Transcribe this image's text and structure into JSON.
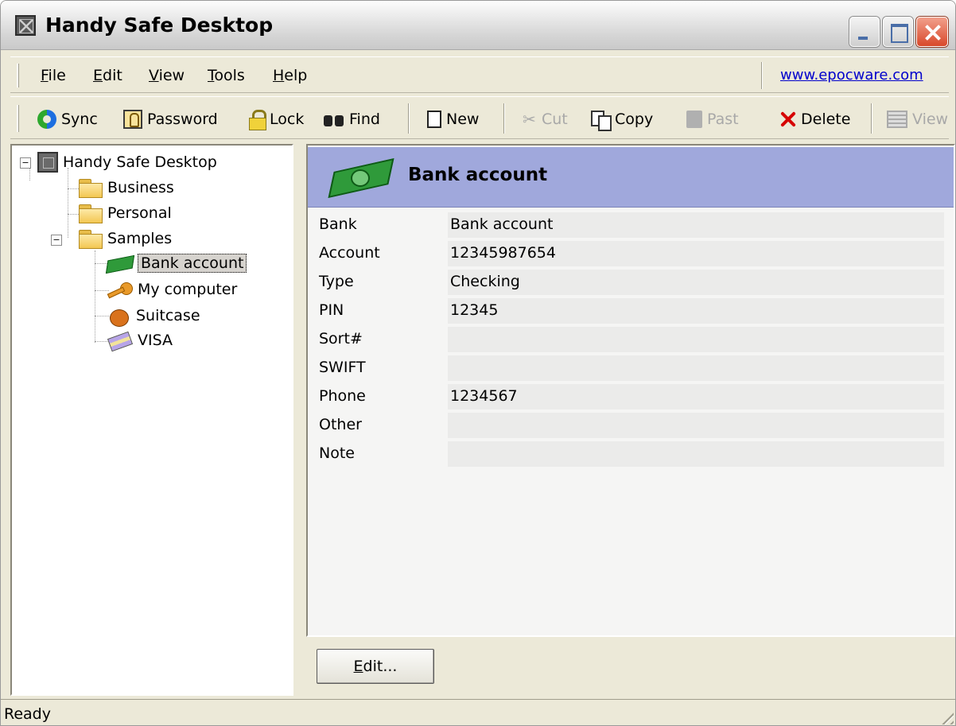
{
  "window": {
    "title": "Handy Safe Desktop"
  },
  "menu": {
    "file": {
      "accel": "F",
      "rest": "ile"
    },
    "edit": {
      "accel": "E",
      "rest": "dit"
    },
    "view": {
      "accel": "V",
      "rest": "iew"
    },
    "tools": {
      "accel": "T",
      "rest": "ools"
    },
    "help": {
      "accel": "H",
      "rest": "elp"
    },
    "website": "www.epocware.com"
  },
  "toolbar": {
    "sync": "Sync",
    "password": "Password",
    "lock": "Lock",
    "find": "Find",
    "new": "New",
    "cut": "Cut",
    "copy": "Copy",
    "paste": "Past",
    "delete": "Delete",
    "view": "View",
    "cut_icon": "✂"
  },
  "tree": {
    "root": "Handy Safe Desktop",
    "items": [
      {
        "label": "Business",
        "icon": "folder-icon"
      },
      {
        "label": "Personal",
        "icon": "folder-icon"
      },
      {
        "label": "Samples",
        "icon": "folder-icon"
      },
      {
        "label": "Bank account",
        "icon": "money-icon",
        "selected": true
      },
      {
        "label": "My computer",
        "icon": "key-icon"
      },
      {
        "label": "Suitcase",
        "icon": "suitcase-icon"
      },
      {
        "label": "VISA",
        "icon": "credit-card-icon"
      }
    ],
    "expanded_toggle": "−"
  },
  "detail": {
    "title": "Bank account",
    "fields": [
      {
        "label": "Bank",
        "value": "Bank account"
      },
      {
        "label": "Account",
        "value": "12345987654"
      },
      {
        "label": "Type",
        "value": "Checking"
      },
      {
        "label": "PIN",
        "value": "12345"
      },
      {
        "label": "Sort#",
        "value": ""
      },
      {
        "label": "SWIFT",
        "value": ""
      },
      {
        "label": "Phone",
        "value": "1234567"
      },
      {
        "label": "Other",
        "value": ""
      },
      {
        "label": "Note",
        "value": ""
      }
    ],
    "edit_button": {
      "accel": "E",
      "rest": "dit..."
    }
  },
  "status": {
    "text": "Ready"
  }
}
